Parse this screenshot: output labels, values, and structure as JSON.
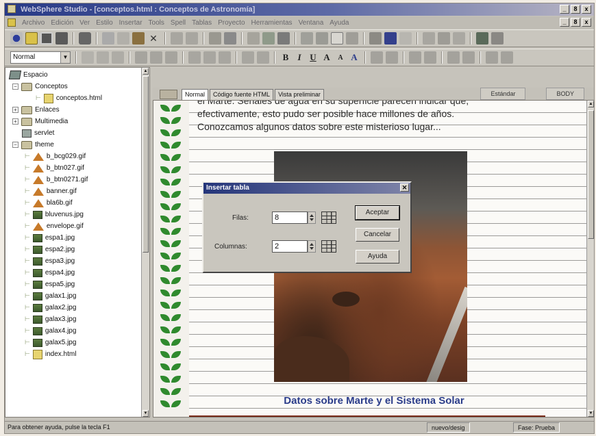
{
  "window": {
    "title": "WebSphere Studio - [conceptos.html : Conceptos de Astronomía]",
    "title_buttons": [
      "_",
      "8",
      "x"
    ],
    "doc_buttons": [
      "_",
      "8",
      "x"
    ]
  },
  "menu": [
    "Archivo",
    "Edición",
    "Ver",
    "Estilo",
    "Insertar",
    "Tools",
    "Spell",
    "Tablas",
    "Proyecto",
    "Herramientas",
    "Ventana",
    "Ayuda"
  ],
  "toolbar2": {
    "style_select": "Normal"
  },
  "tree": {
    "root": "Espacio",
    "items": [
      {
        "label": "Conceptos",
        "type": "folder"
      },
      {
        "label": "conceptos.html",
        "type": "html"
      },
      {
        "label": "Enlaces",
        "type": "folder"
      },
      {
        "label": "Multimedia",
        "type": "folder"
      },
      {
        "label": "servlet",
        "type": "servlet"
      },
      {
        "label": "theme",
        "type": "folder"
      },
      {
        "label": "b_bcg029.gif",
        "type": "gif"
      },
      {
        "label": "b_btn027.gif",
        "type": "gif"
      },
      {
        "label": "b_btn0271.gif",
        "type": "gif"
      },
      {
        "label": "banner.gif",
        "type": "gif"
      },
      {
        "label": "bla6b.gif",
        "type": "gif"
      },
      {
        "label": "bluvenus.jpg",
        "type": "img"
      },
      {
        "label": "envelope.gif",
        "type": "gif"
      },
      {
        "label": "espa1.jpg",
        "type": "img"
      },
      {
        "label": "espa2.jpg",
        "type": "img"
      },
      {
        "label": "espa3.jpg",
        "type": "img"
      },
      {
        "label": "espa4.jpg",
        "type": "img"
      },
      {
        "label": "espa5.jpg",
        "type": "img"
      },
      {
        "label": "galax1.jpg",
        "type": "img"
      },
      {
        "label": "galax2.jpg",
        "type": "img"
      },
      {
        "label": "galax3.jpg",
        "type": "img"
      },
      {
        "label": "galax4.jpg",
        "type": "img"
      },
      {
        "label": "galax5.jpg",
        "type": "img"
      },
      {
        "label": "index.html",
        "type": "html"
      }
    ]
  },
  "editor": {
    "tabs": [
      "Normal",
      "Código fuente HTML",
      "Vista preliminar"
    ],
    "right_labels": [
      "Estándar",
      "BODY"
    ],
    "text_lines": [
      "el Marte. Señales de agua en su superficie parecen indicar que,",
      "efectivamente, esto pudo ser posible hace millones de años.",
      "Conozcamos algunos datos sobre este misterioso lugar..."
    ],
    "heading": "Datos sobre Marte y el Sistema Solar"
  },
  "dialog": {
    "title": "Insertar tabla",
    "rows_label": "Filas:",
    "rows_value": "8",
    "cols_label": "Columnas:",
    "cols_value": "2",
    "accept": "Aceptar",
    "cancel": "Cancelar",
    "help": "Ayuda"
  },
  "status": {
    "message": "Para obtener ayuda, pulse la tecla F1",
    "panel1": "nuevo/desig",
    "panel2": "Fase: Prueba"
  }
}
